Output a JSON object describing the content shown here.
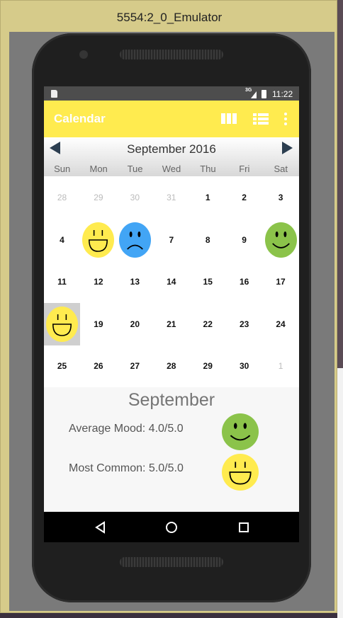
{
  "window": {
    "title": "5554:2_0_Emulator"
  },
  "status_bar": {
    "network": "3G",
    "time": "11:22"
  },
  "app_bar": {
    "title": "Calendar",
    "actions": [
      "week-view-icon",
      "list-view-icon",
      "more-vert-icon"
    ]
  },
  "calendar": {
    "month_label": "September 2016",
    "weekdays": [
      "Sun",
      "Mon",
      "Tue",
      "Wed",
      "Thu",
      "Fri",
      "Sat"
    ],
    "weeks": [
      [
        {
          "day": "28",
          "muted": true
        },
        {
          "day": "29",
          "muted": true
        },
        {
          "day": "30",
          "muted": true
        },
        {
          "day": "31",
          "muted": true
        },
        {
          "day": "1"
        },
        {
          "day": "2"
        },
        {
          "day": "3"
        }
      ],
      [
        {
          "day": "4"
        },
        {
          "mood": "ecstatic"
        },
        {
          "mood": "sad"
        },
        {
          "day": "7"
        },
        {
          "day": "8"
        },
        {
          "day": "9"
        },
        {
          "mood": "happy"
        }
      ],
      [
        {
          "day": "11"
        },
        {
          "day": "12"
        },
        {
          "day": "13"
        },
        {
          "day": "14"
        },
        {
          "day": "15"
        },
        {
          "day": "16"
        },
        {
          "day": "17"
        }
      ],
      [
        {
          "mood": "ecstatic",
          "selected": true
        },
        {
          "day": "19"
        },
        {
          "day": "20"
        },
        {
          "day": "21"
        },
        {
          "day": "22"
        },
        {
          "day": "23"
        },
        {
          "day": "24"
        }
      ],
      [
        {
          "day": "25"
        },
        {
          "day": "26"
        },
        {
          "day": "27"
        },
        {
          "day": "28"
        },
        {
          "day": "29"
        },
        {
          "day": "30"
        },
        {
          "day": "1",
          "muted": true
        }
      ]
    ],
    "mood_colors": {
      "ecstatic": "#ffeb4f",
      "happy": "#8bc34a",
      "sad": "#42a5f5"
    }
  },
  "summary": {
    "title": "September",
    "average": "Average Mood: 4.0/5.0",
    "average_mood": "happy",
    "common": "Most Common: 5.0/5.0",
    "common_mood": "ecstatic"
  },
  "nav_bar": {
    "buttons": [
      "back-icon",
      "home-icon",
      "recents-icon"
    ]
  },
  "colors": {
    "accent": "#ffeb4f",
    "status_bar": "#4d4d4d"
  }
}
